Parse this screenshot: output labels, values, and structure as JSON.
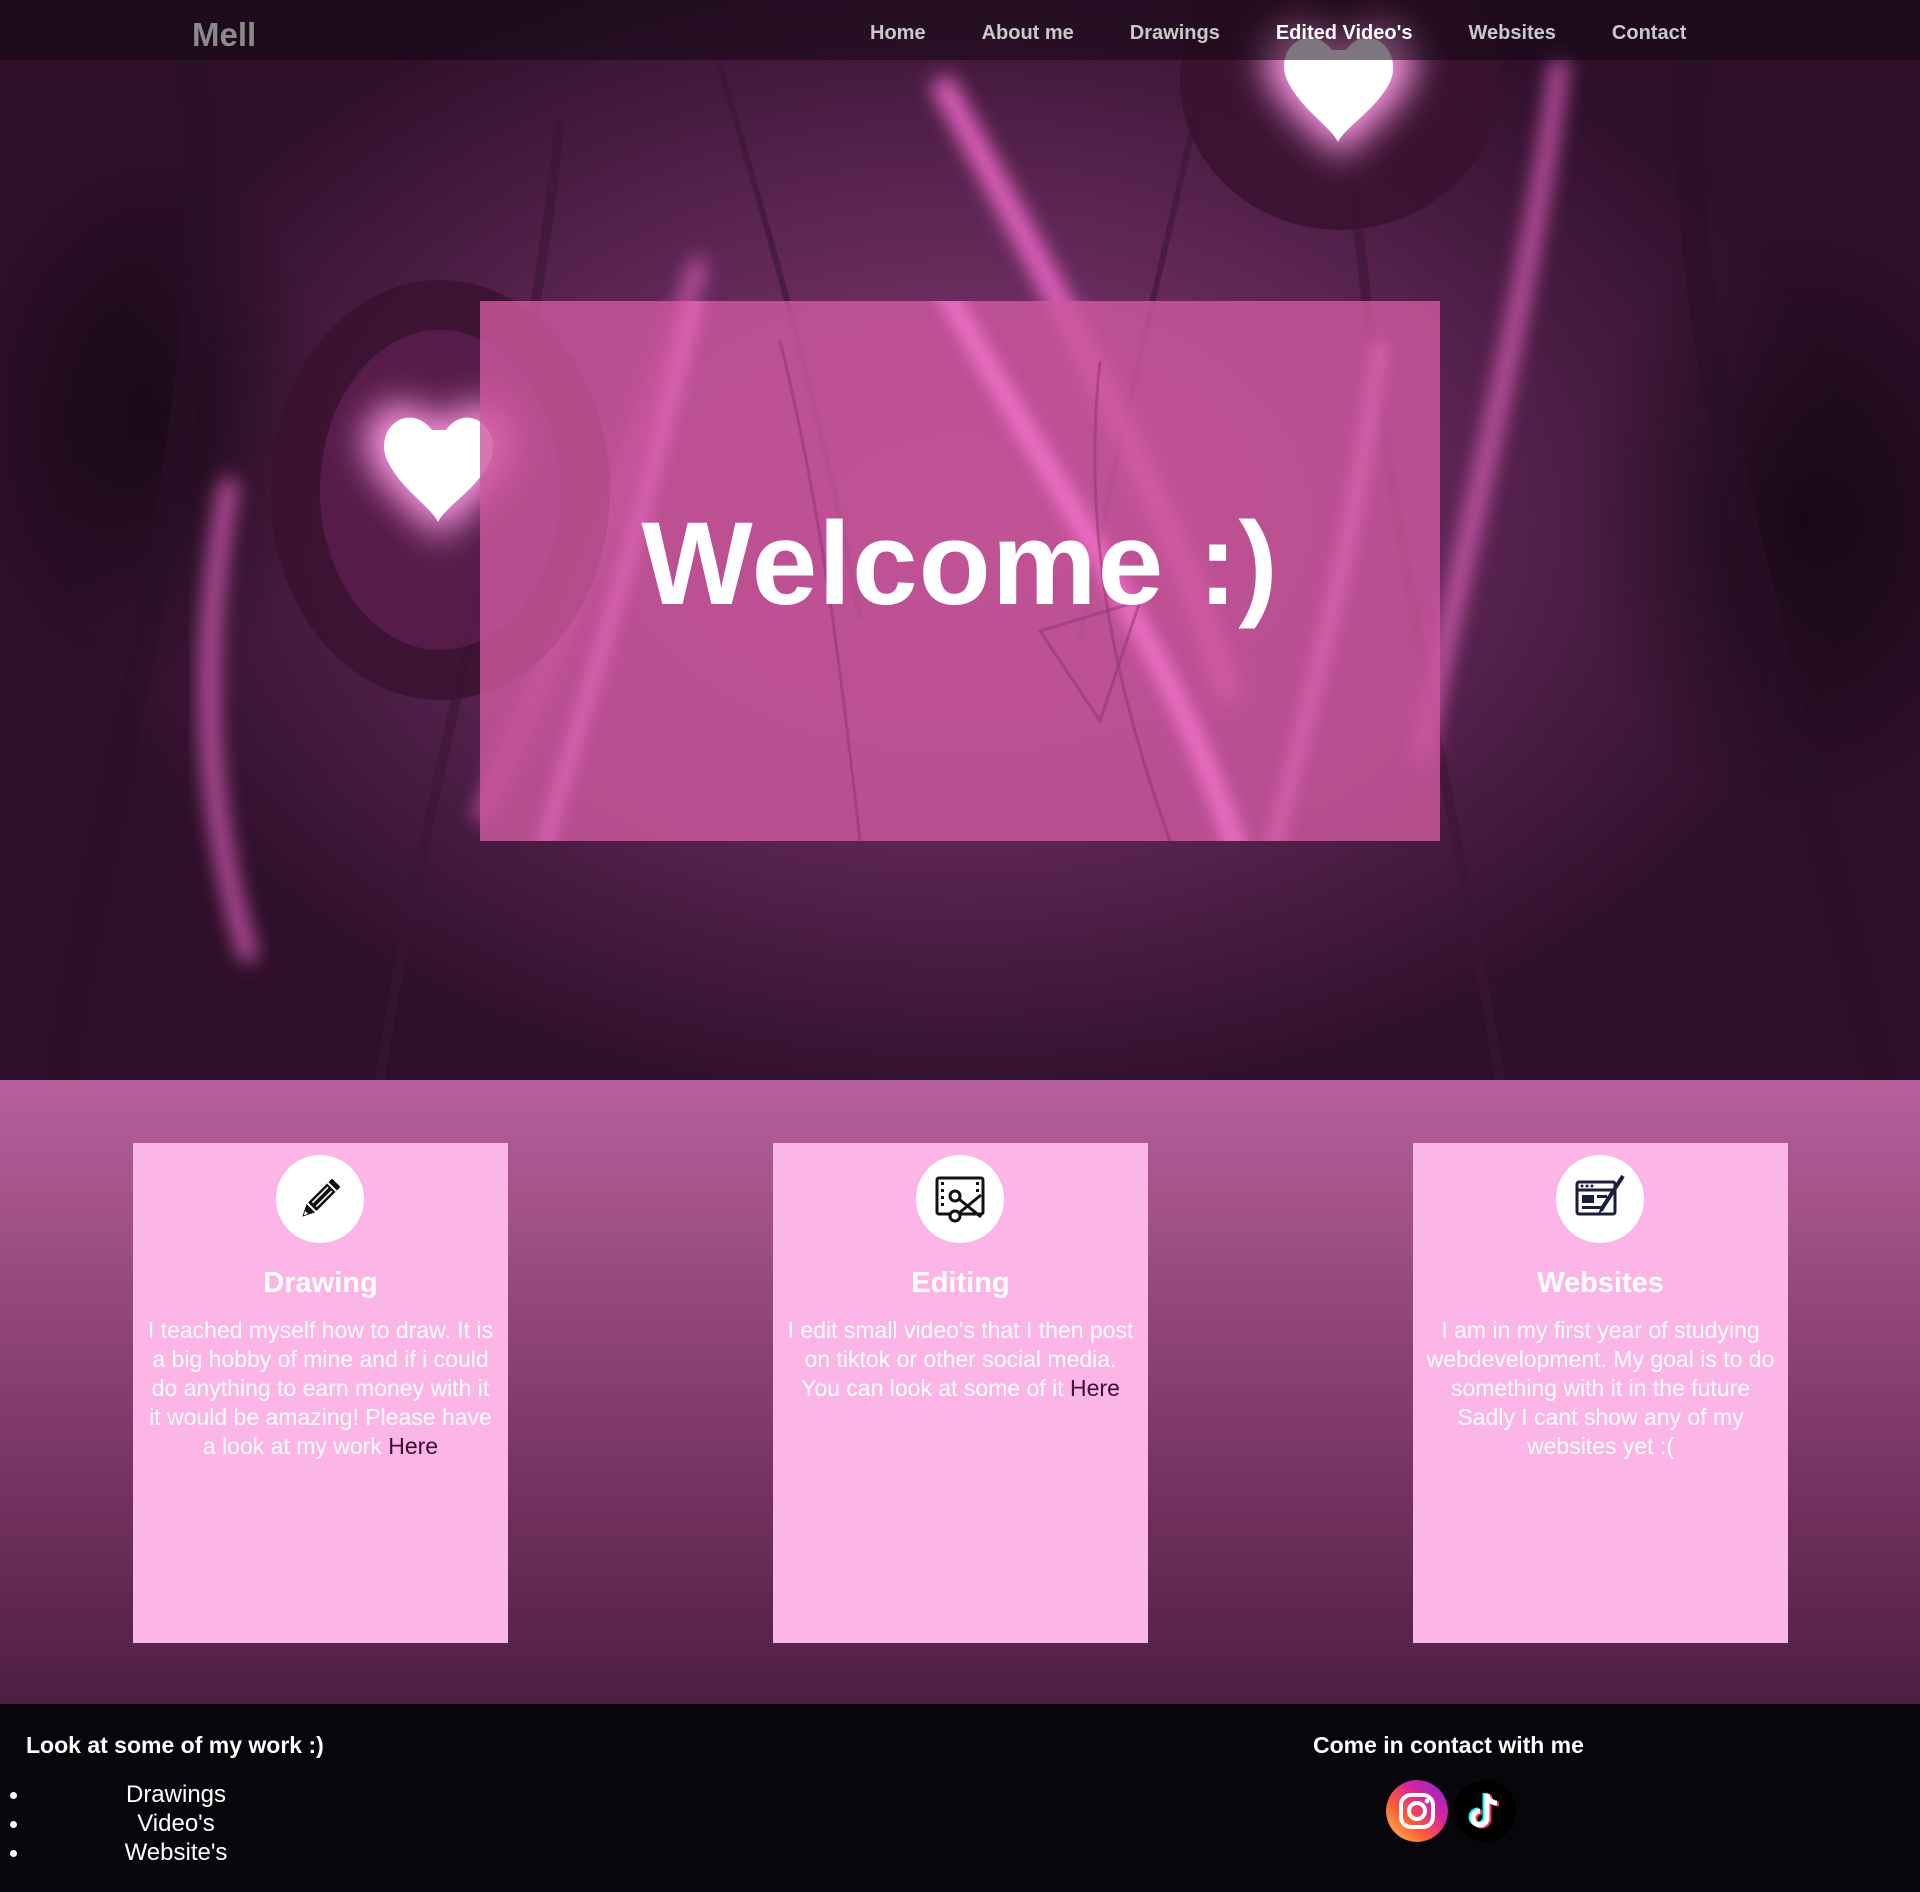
{
  "nav": {
    "brand": "Mell",
    "links": [
      "Home",
      "About me",
      "Drawings",
      "Edited Video's",
      "Websites",
      "Contact"
    ],
    "active_index": 3
  },
  "hero": {
    "title": "Welcome :)"
  },
  "services": [
    {
      "title": "Drawing",
      "text": "I teached myself how to draw. It is a big hobby of mine and if i could do anything to earn money with it it would be amazing! Please have a look at my work",
      "link_label": "Here",
      "icon": "pencil-icon"
    },
    {
      "title": "Editing",
      "text": "I edit small video's that I then post on tiktok or other social media. You can look at some of it",
      "link_label": "Here",
      "icon": "video-edit-icon"
    },
    {
      "title": "Websites",
      "text": "I am in my first year of studying webdevelopment. My goal is to do something with it in the future Sadly I cant show any of my websites yet :(",
      "link_label": "",
      "icon": "web-design-icon"
    }
  ],
  "footer": {
    "work_heading": "Look at some of my work :)",
    "work_links": [
      "Drawings",
      "Video's",
      "Website's"
    ],
    "contact_heading": "Come in contact with me",
    "social": [
      "instagram-icon",
      "tiktok-icon"
    ]
  },
  "colors": {
    "card_bg": "#fbb5e6",
    "welcome_box": "#cd589e",
    "footer_bg": "#07070b",
    "services_top": "#b7609e",
    "services_bottom": "#4e1e42"
  }
}
